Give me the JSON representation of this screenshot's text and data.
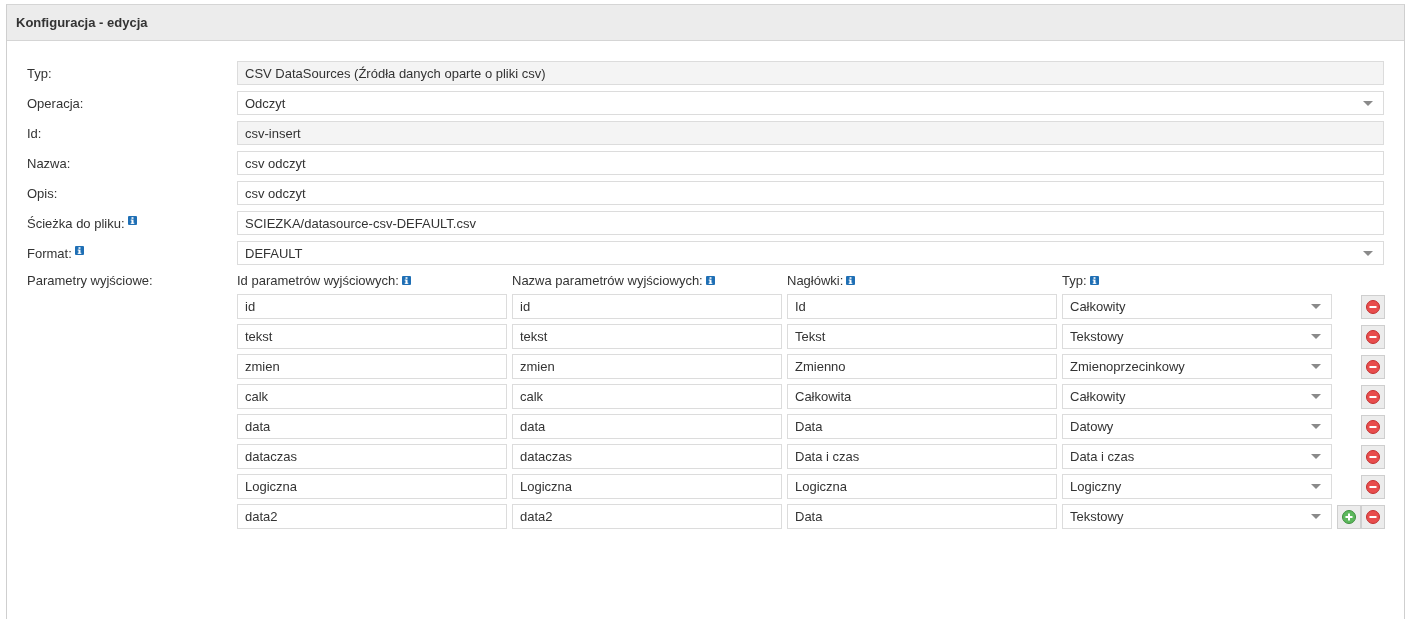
{
  "panel": {
    "title": "Konfiguracja - edycja"
  },
  "fields": [
    {
      "label": "Typ:",
      "value": "CSV DataSources (Źródła danych oparte o pliki csv)",
      "kind": "readonly",
      "info": false
    },
    {
      "label": "Operacja:",
      "value": "Odczyt",
      "kind": "select",
      "info": false
    },
    {
      "label": "Id:",
      "value": "csv-insert",
      "kind": "readonly",
      "info": false
    },
    {
      "label": "Nazwa:",
      "value": "csv odczyt",
      "kind": "text",
      "info": false
    },
    {
      "label": "Opis:",
      "value": "csv odczyt",
      "kind": "text",
      "info": false
    },
    {
      "label": "Ścieżka do pliku:",
      "value": "SCIEZKA/datasource-csv-DEFAULT.csv",
      "kind": "text",
      "info": true
    },
    {
      "label": "Format:",
      "value": "DEFAULT",
      "kind": "select",
      "info": true
    }
  ],
  "parameters": {
    "label": "Parametry wyjściowe:",
    "columns": [
      {
        "label": "Id parametrów wyjściowych:",
        "info": true
      },
      {
        "label": "Nazwa parametrów wyjściowych:",
        "info": true
      },
      {
        "label": "Nagłówki:",
        "info": true
      },
      {
        "label": "Typ:",
        "info": true
      }
    ],
    "rows": [
      {
        "id": "id",
        "name": "id",
        "header": "Id",
        "type": "Całkowity",
        "add": false
      },
      {
        "id": "tekst",
        "name": "tekst",
        "header": "Tekst",
        "type": "Tekstowy",
        "add": false
      },
      {
        "id": "zmien",
        "name": "zmien",
        "header": "Zmienno",
        "type": "Zmienoprzecinkowy",
        "add": false
      },
      {
        "id": "calk",
        "name": "calk",
        "header": "Całkowita",
        "type": "Całkowity",
        "add": false
      },
      {
        "id": "data",
        "name": "data",
        "header": "Data",
        "type": "Datowy",
        "add": false
      },
      {
        "id": "dataczas",
        "name": "dataczas",
        "header": "Data i czas",
        "type": "Data i czas",
        "add": false
      },
      {
        "id": "Logiczna",
        "name": "Logiczna",
        "header": "Logiczna",
        "type": "Logiczny",
        "add": false
      },
      {
        "id": "data2",
        "name": "data2",
        "header": "Data",
        "type": "Tekstowy",
        "add": true
      }
    ]
  }
}
